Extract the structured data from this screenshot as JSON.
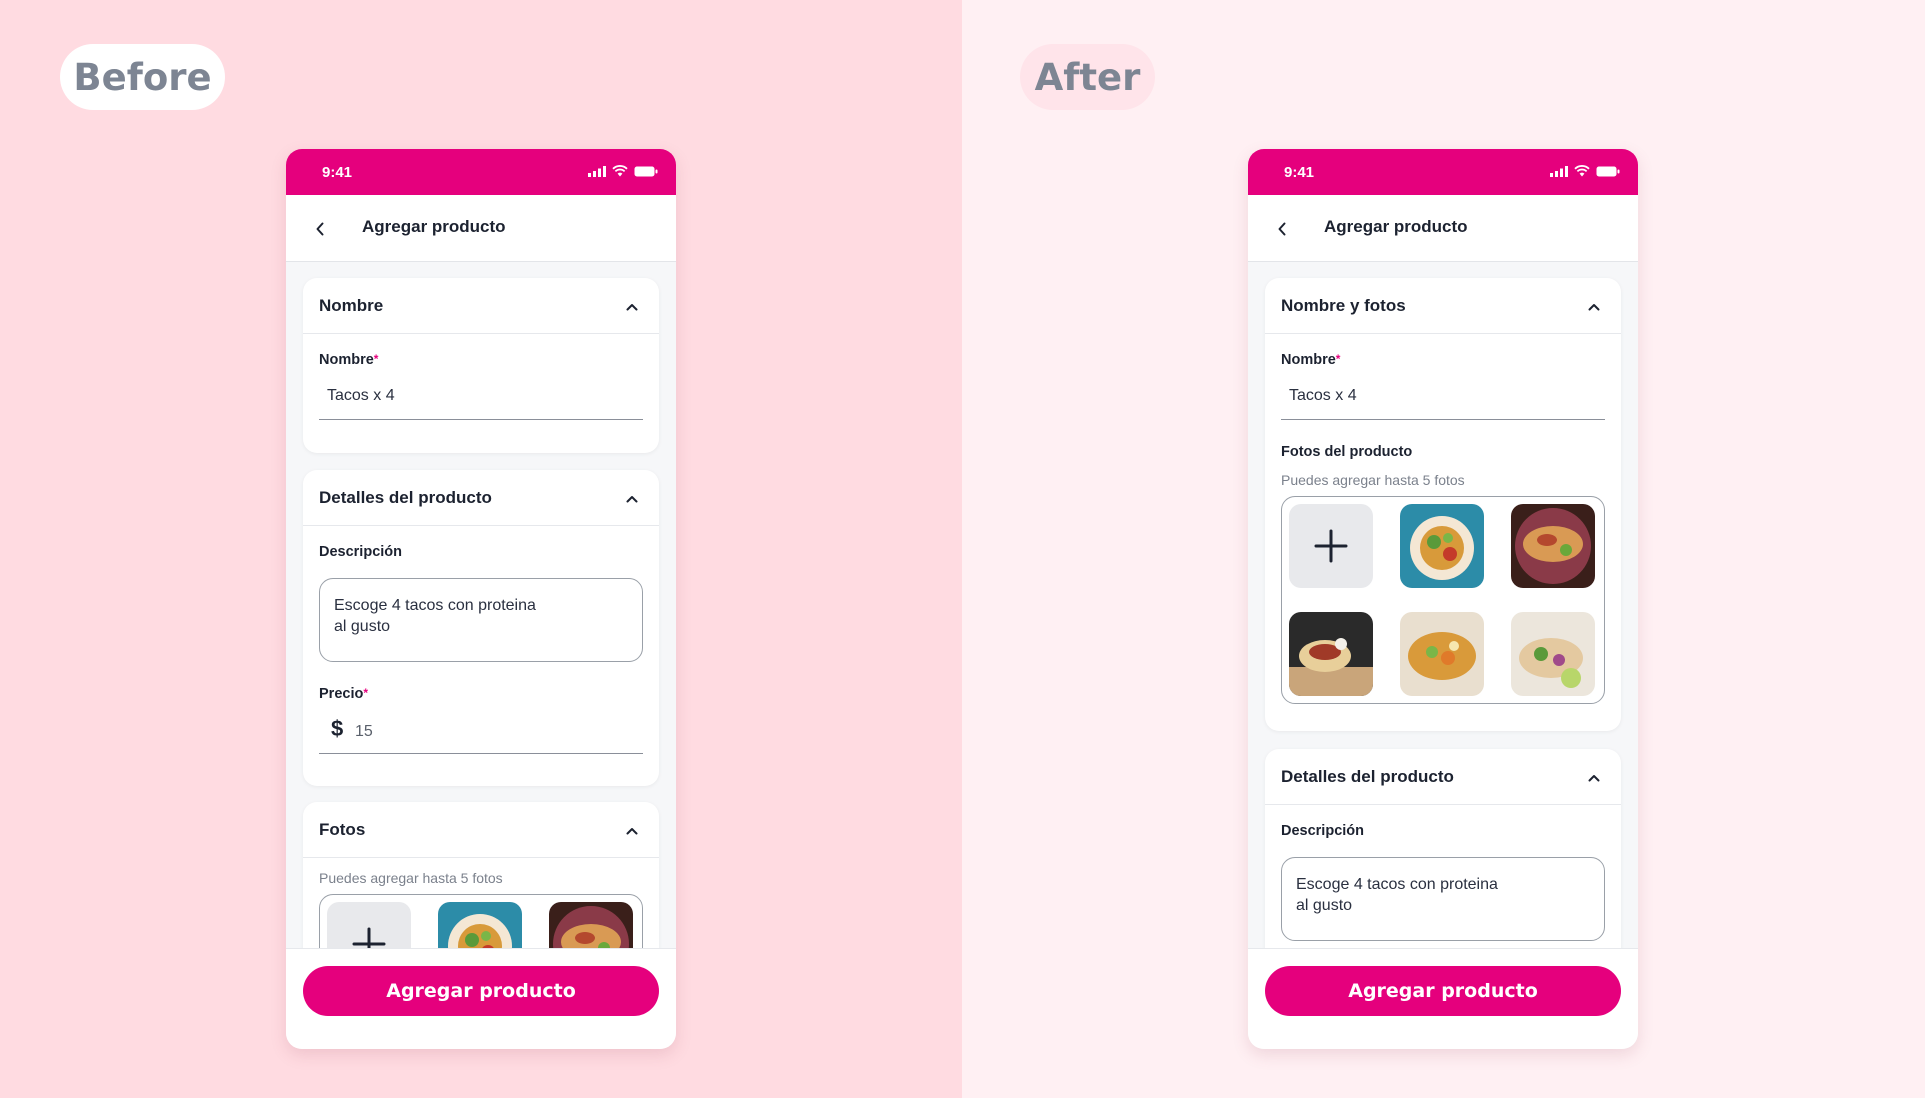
{
  "labels": {
    "before": "Before",
    "after": "After"
  },
  "colors": {
    "brand": "#e5007d",
    "left_bg": "#ffdbe1",
    "right_bg": "#fff0f3"
  },
  "before_screen": {
    "status_time": "9:41",
    "nav_title": "Agregar producto",
    "sections": {
      "nombre": {
        "title": "Nombre",
        "field_label": "Nombre",
        "required_mark": "*",
        "value": "Tacos x 4"
      },
      "detalles": {
        "title": "Detalles del producto",
        "description_label": "Descripción",
        "description_value": "Escoge 4 tacos con proteina\nal gusto",
        "price_label": "Precio",
        "required_mark": "*",
        "currency": "$",
        "price_value": "15"
      },
      "fotos": {
        "title": "Fotos",
        "hint": "Puedes agregar hasta 5 fotos"
      }
    },
    "cta": "Agregar producto"
  },
  "after_screen": {
    "status_time": "9:41",
    "nav_title": "Agregar producto",
    "sections": {
      "nombre_fotos": {
        "title": "Nombre y fotos",
        "field_label": "Nombre",
        "required_mark": "*",
        "value": "Tacos x 4",
        "photos_label": "Fotos del producto",
        "photos_hint": "Puedes agregar hasta 5 fotos"
      },
      "detalles": {
        "title": "Detalles del producto",
        "description_label": "Descripción",
        "description_value": "Escoge 4 tacos con proteina\nal gusto"
      }
    },
    "cta": "Agregar producto"
  },
  "icons": [
    "back-chevron-icon",
    "chevron-up-icon",
    "plus-icon",
    "signal-icon",
    "wifi-icon",
    "battery-icon"
  ]
}
